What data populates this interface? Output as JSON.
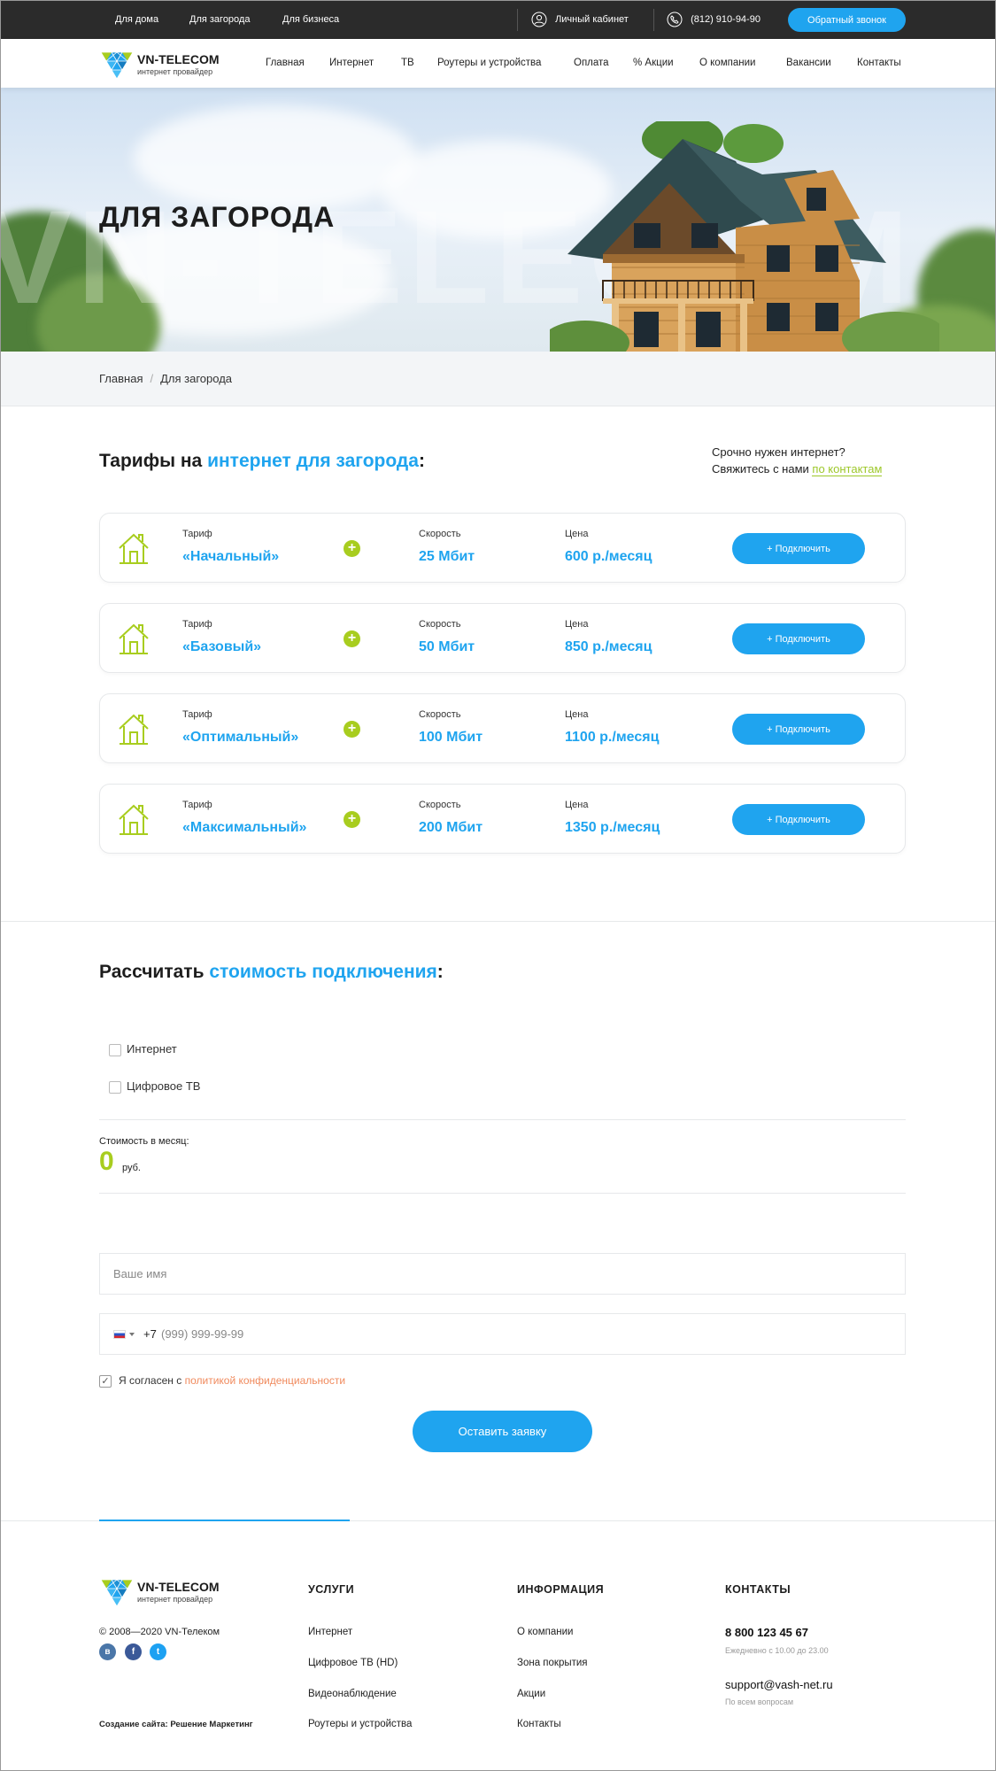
{
  "topbar": {
    "segments": [
      "Для дома",
      "Для загорода",
      "Для бизнеса"
    ],
    "account": "Личный кабинет",
    "phone": "(812) 910-94-90",
    "callback": "Обратный звонок"
  },
  "header": {
    "brand": "VN-TELECOM",
    "subtitle": "интернет провайдер",
    "nav": [
      "Главная",
      "Интернет",
      "ТВ",
      "Роутеры и устройства",
      "Оплата",
      "% Акции",
      "О компании",
      "Вакансии",
      "Контакты"
    ]
  },
  "hero": {
    "title": "ДЛЯ ЗАГОРОДА",
    "watermark": "VN-TELECOM"
  },
  "breadcrumb": {
    "home": "Главная",
    "separator": "/",
    "current": "Для загорода"
  },
  "tariffs": {
    "title_plain": "Тарифы на ",
    "title_accent": "интернет для загорода",
    "title_end": ":",
    "urgent_line1": "Срочно нужен интернет?",
    "urgent_line2": "Свяжитесь с нами ",
    "urgent_link": "по контактам",
    "labels": {
      "tariff": "Тариф",
      "speed": "Скорость",
      "price": "Цена"
    },
    "plus": "+",
    "button": "+ Подключить",
    "items": [
      {
        "name": "«Начальный»",
        "speed": "25 Мбит",
        "price": "600 р./месяц"
      },
      {
        "name": "«Базовый»",
        "speed": "50 Мбит",
        "price": "850 р./месяц"
      },
      {
        "name": "«Оптимальный»",
        "speed": "100 Мбит",
        "price": "1100 р./месяц"
      },
      {
        "name": "«Максимальный»",
        "speed": "200 Мбит",
        "price": "1350 р./месяц"
      }
    ]
  },
  "calc": {
    "title_plain": "Рассчитать ",
    "title_accent": "стоимость подключения",
    "title_end": ":",
    "options": [
      "Интернет",
      "Цифровое ТВ"
    ],
    "cost_label": "Стоимость в месяц:",
    "cost_value": "0",
    "cost_unit": "руб."
  },
  "form": {
    "name_placeholder": "Ваше имя",
    "phone_code": "+7",
    "phone_placeholder": "(999) 999-99-99",
    "agree_text": "Я согласен с ",
    "agree_link": "политикой конфиденциальности",
    "submit": "Оставить заявку"
  },
  "footer": {
    "brand": "VN-TELECOM",
    "subtitle": "интернет провайдер",
    "copyright": "© 2008—2020 VN-Телеком",
    "social": [
      "vk-icon",
      "facebook-icon",
      "twitter-icon"
    ],
    "credit": "Создание сайта: Решение Маркетинг",
    "services_title": "УСЛУГИ",
    "services": [
      "Интернет",
      "Цифровое ТВ (HD)",
      "Видеонаблюдение",
      "Роутеры и устройства"
    ],
    "info_title": "ИНФОРМАЦИЯ",
    "info": [
      "О компании",
      "Зона покрытия",
      "Акции",
      "Контакты"
    ],
    "contacts_title": "КОНТАКТЫ",
    "phone": "8 800 123 45 67",
    "phone_note": "Ежедневно с 10.00 до 23.00",
    "email": "support@vash-net.ru",
    "email_note": "По всем вопросам"
  },
  "colors": {
    "accent": "#1fa4ef",
    "lime": "#a8cd1f",
    "topbar": "#2b2b2b",
    "link_orange": "#f08a5d"
  }
}
